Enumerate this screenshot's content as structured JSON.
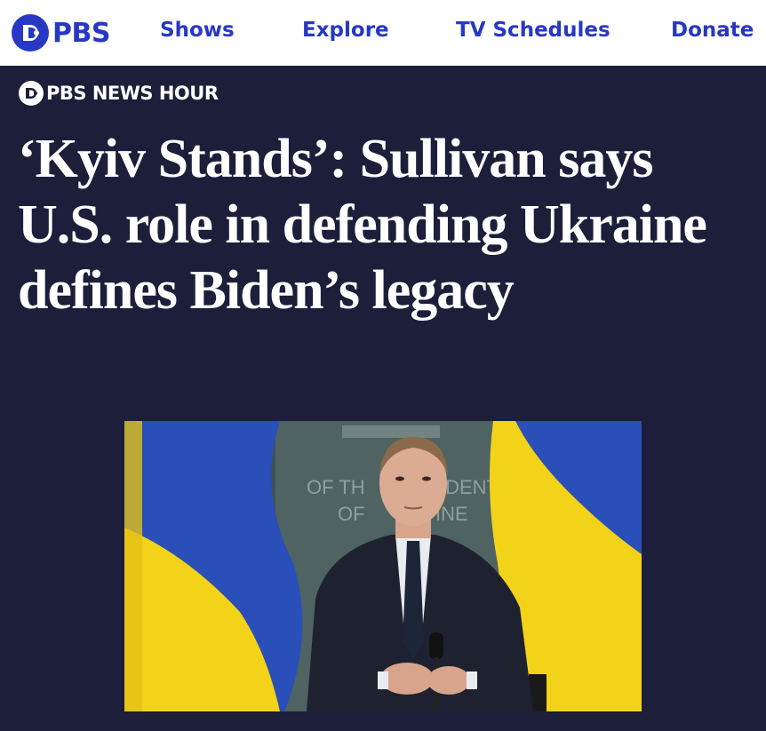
{
  "nav": {
    "brand": "PBS",
    "links": [
      "Shows",
      "Explore",
      "TV Schedules",
      "Donate"
    ],
    "accent_color": "#2638c4"
  },
  "show": {
    "label": "PBS NEWS HOUR"
  },
  "article": {
    "headline": "‘Kyiv Stands’: Sullivan says U.S. role in defending Ukraine defines Biden’s legacy",
    "image": {
      "backdrop_text_line1": "OF TH",
      "backdrop_text_line1b": "IDENT",
      "backdrop_text_line2": "OF",
      "backdrop_text_line2b": "INE",
      "flag_colors": [
        "#2b4fb8",
        "#f3d21a"
      ]
    }
  },
  "colors": {
    "page_background": "#1c1e3a",
    "nav_background": "#ffffff"
  }
}
